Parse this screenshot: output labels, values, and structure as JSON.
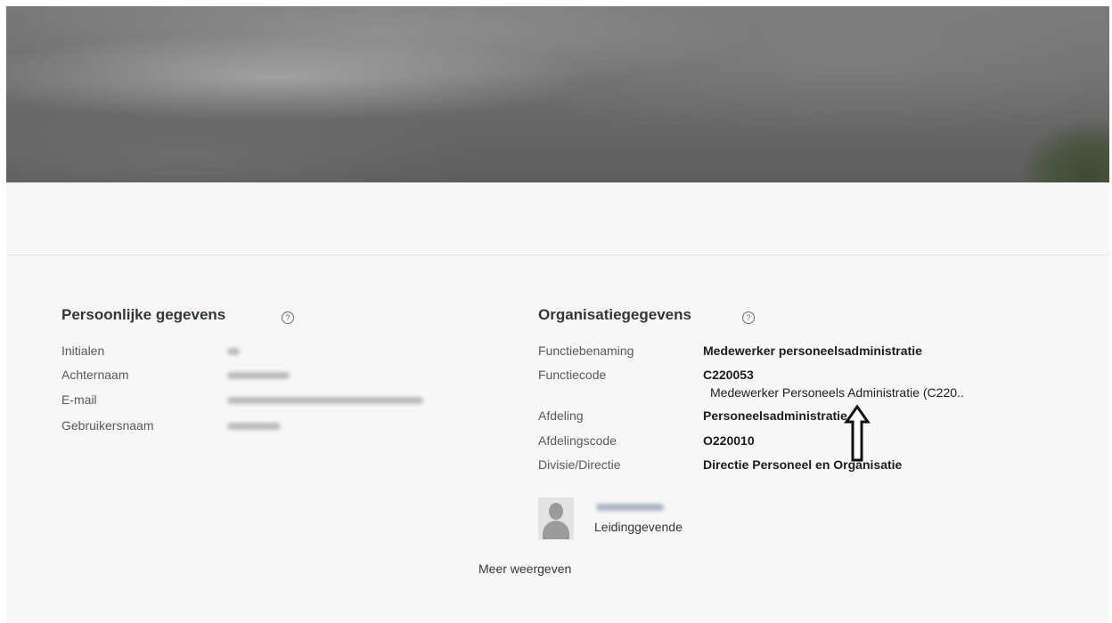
{
  "personal": {
    "title": "Persoonlijke gegevens",
    "help_icon": "help-icon",
    "fields": [
      {
        "label": "Initialen"
      },
      {
        "label": "Achternaam"
      },
      {
        "label": "E-mail"
      },
      {
        "label": "Gebruikersnaam"
      }
    ]
  },
  "organisation": {
    "title": "Organisatiegegevens",
    "help_icon": "help-icon",
    "fields": [
      {
        "label": "Functiebenaming",
        "value": "Medewerker personeelsadministratie"
      },
      {
        "label": "Functiecode",
        "value": "C220053",
        "sub_value": "Medewerker Personeels Administratie (C220.."
      },
      {
        "label": "Afdeling",
        "value": "Personeelsadministratie"
      },
      {
        "label": "Afdelingscode",
        "value": "O220010"
      },
      {
        "label": "Divisie/Directie",
        "value": "Directie Personeel en Organisatie"
      }
    ],
    "manager": {
      "role": "Leidinggevende"
    }
  },
  "more_link": "Meer weergeven",
  "annotation_arrow": "up-arrow"
}
